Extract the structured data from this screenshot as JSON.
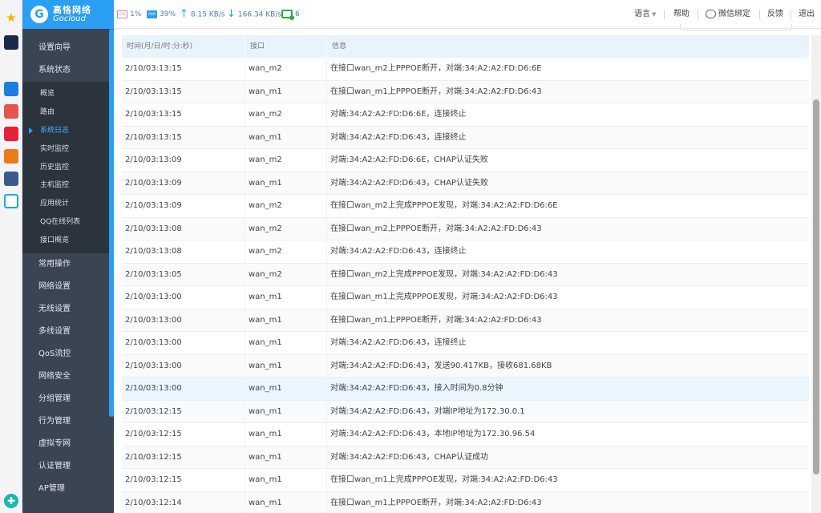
{
  "header": {
    "logo_cn": "高恪网络",
    "logo_en": "Gocloud",
    "cpu_label": "CPU",
    "cpu": "1%",
    "ram_label": "RAM",
    "ram": "39%",
    "upload": "8.15 KB/s",
    "download": "166.34 KB/s",
    "devices": "6",
    "language": "语言",
    "help": "帮助",
    "wechat": "微信绑定",
    "feedback": "反馈",
    "logout": "退出"
  },
  "sidebar": {
    "top": [
      "设置向导",
      "系统状态"
    ],
    "sub": [
      "概览",
      "路由",
      "系统日志",
      "实时监控",
      "历史监控",
      "主机监控",
      "应用统计",
      "QQ在线列表",
      "接口概览"
    ],
    "active_sub": "系统日志",
    "bottom": [
      "常用操作",
      "网络设置",
      "无线设置",
      "多线设置",
      "QoS流控",
      "网络安全",
      "分组管理",
      "行为管理",
      "虚拟专网",
      "认证管理",
      "AP管理"
    ]
  },
  "table": {
    "headers": [
      "时间(月/日/时:分:秒)",
      "接口",
      "信息"
    ],
    "rows": [
      {
        "time": "2/10/03:13:15",
        "iface": "wan_m2",
        "info": "在接口wan_m2上PPPOE断开，对端:34:A2:A2:FD:D6:6E"
      },
      {
        "time": "2/10/03:13:15",
        "iface": "wan_m1",
        "info": "在接口wan_m1上PPPOE断开，对端:34:A2:A2:FD:D6:43"
      },
      {
        "time": "2/10/03:13:15",
        "iface": "wan_m2",
        "info": "对端:34:A2:A2:FD:D6:6E，连接终止"
      },
      {
        "time": "2/10/03:13:15",
        "iface": "wan_m1",
        "info": "对端:34:A2:A2:FD:D6:43，连接终止"
      },
      {
        "time": "2/10/03:13:09",
        "iface": "wan_m2",
        "info": "对端:34:A2:A2:FD:D6:6E，CHAP认证失败"
      },
      {
        "time": "2/10/03:13:09",
        "iface": "wan_m1",
        "info": "对端:34:A2:A2:FD:D6:43，CHAP认证失败"
      },
      {
        "time": "2/10/03:13:09",
        "iface": "wan_m2",
        "info": "在接口wan_m2上完成PPPOE发现，对端:34:A2:A2:FD:D6:6E"
      },
      {
        "time": "2/10/03:13:08",
        "iface": "wan_m2",
        "info": "在接口wan_m2上PPPOE断开，对端:34:A2:A2:FD:D6:43"
      },
      {
        "time": "2/10/03:13:08",
        "iface": "wan_m2",
        "info": "对端:34:A2:A2:FD:D6:43，连接终止"
      },
      {
        "time": "2/10/03:13:05",
        "iface": "wan_m2",
        "info": "在接口wan_m2上完成PPPOE发现，对端:34:A2:A2:FD:D6:43"
      },
      {
        "time": "2/10/03:13:00",
        "iface": "wan_m1",
        "info": "在接口wan_m1上完成PPPOE发现，对端:34:A2:A2:FD:D6:43"
      },
      {
        "time": "2/10/03:13:00",
        "iface": "wan_m1",
        "info": "在接口wan_m1上PPPOE断开，对端:34:A2:A2:FD:D6:43"
      },
      {
        "time": "2/10/03:13:00",
        "iface": "wan_m1",
        "info": "对端:34:A2:A2:FD:D6:43，连接终止"
      },
      {
        "time": "2/10/03:13:00",
        "iface": "wan_m1",
        "info": "对端:34:A2:A2:FD:D6:43，发送90.417KB，接收681.68KB"
      },
      {
        "time": "2/10/03:13:00",
        "iface": "wan_m1",
        "info": "对端:34:A2:A2:FD:D6:43，接入时间为0.8分钟"
      },
      {
        "time": "2/10/03:12:15",
        "iface": "wan_m1",
        "info": "对端:34:A2:A2:FD:D6:43，对端IP地址为172.30.0.1"
      },
      {
        "time": "2/10/03:12:15",
        "iface": "wan_m1",
        "info": "对端:34:A2:A2:FD:D6:43，本地IP地址为172.30.96.54"
      },
      {
        "time": "2/10/03:12:15",
        "iface": "wan_m1",
        "info": "对端:34:A2:A2:FD:D6:43，CHAP认证成功"
      },
      {
        "time": "2/10/03:12:15",
        "iface": "wan_m1",
        "info": "在接口wan_m1上完成PPPOE发现，对端:34:A2:A2:FD:D6:43"
      },
      {
        "time": "2/10/03:12:14",
        "iface": "wan_m1",
        "info": "在接口wan_m1上PPPOE断开，对端:34:A2:A2:FD:D6:43"
      }
    ],
    "highlighted_row": 14
  },
  "colors": {
    "brand": "#2a9ff4",
    "sidebar_bg": "#3a4553",
    "submenu_bg": "#2b333d",
    "header_row_bg": "#e9f3fc",
    "highlight_row_bg": "#eaf5fd"
  },
  "icons": {
    "strip": [
      "star-icon",
      "app-icon-1",
      "app-icon-2",
      "app-icon-3",
      "app-icon-4",
      "app-icon-5",
      "app-icon-6",
      "app-icon-7"
    ],
    "float": "customer-service-icon"
  }
}
